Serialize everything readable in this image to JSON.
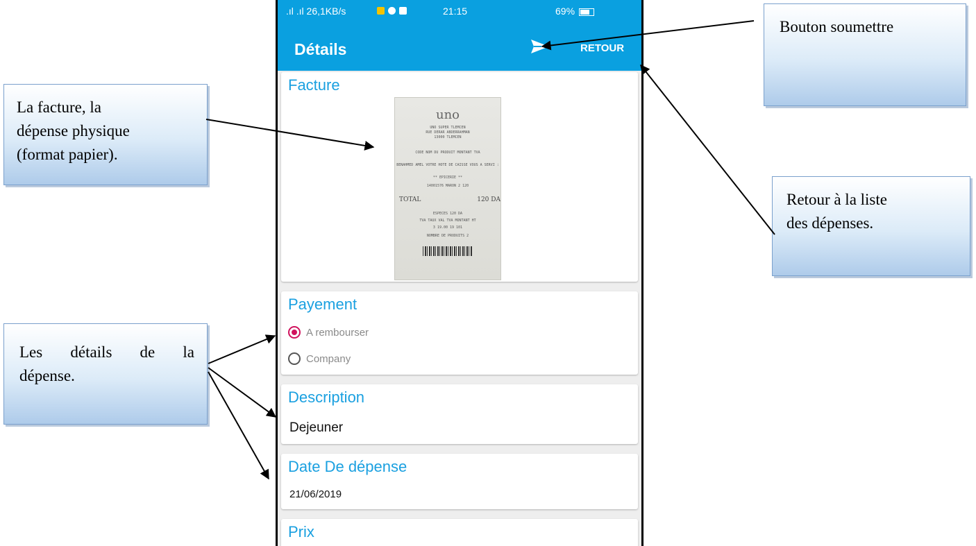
{
  "status_bar": {
    "left": ".ıl .ıl 26,1KB/s",
    "time": "21:15",
    "right": "69%"
  },
  "app_bar": {
    "title": "Détails",
    "back_label": "RETOUR"
  },
  "invoice_card": {
    "title": "Facture",
    "receipt_lines": {
      "logo": "uno",
      "line1": "UNO SUPER TLEMCEN",
      "line2": "RUE DERAR ABDERRAHMAN",
      "line3": "13000 TLEMCEN",
      "header": "CODE   NOM DU PRODUIT   MONTANT TVA",
      "cashier": "BENAHMED AMEL VOTRE HOTE DE CAISSE VOUS A SERVI :",
      "section": "** EPICERIE **",
      "item": "14001576 MARON    2      120",
      "total_label": "TOTAL",
      "total_value": "120 DA",
      "especes": "ESPECES                 120 DA",
      "tva": "TVA  TAUX   VAL TVA   MONTANT HT",
      "tva_row": "3   19.00     19        101",
      "count": "NOMBRE DE PRODUITS            2"
    }
  },
  "payment_card": {
    "title": "Payement",
    "options": [
      {
        "label": "A rembourser",
        "selected": true
      },
      {
        "label": "Company",
        "selected": false
      }
    ]
  },
  "description_card": {
    "title": "Description",
    "value": "Dejeuner"
  },
  "date_card": {
    "title": "Date De dépense",
    "value": "21/06/2019"
  },
  "price_card": {
    "title": "Prix"
  },
  "callouts": {
    "invoice": [
      "La facture, la",
      "dépense physique",
      "(format papier)."
    ],
    "details": [
      "Les détails de la",
      "dépense."
    ],
    "submit": [
      "Bouton soumettre"
    ],
    "back": [
      "Retour à la liste",
      "des dépenses."
    ]
  },
  "colors": {
    "app_bar": "#0aa0e0",
    "accent_title": "#1aa0e0",
    "radio_selected": "#d0125d"
  }
}
